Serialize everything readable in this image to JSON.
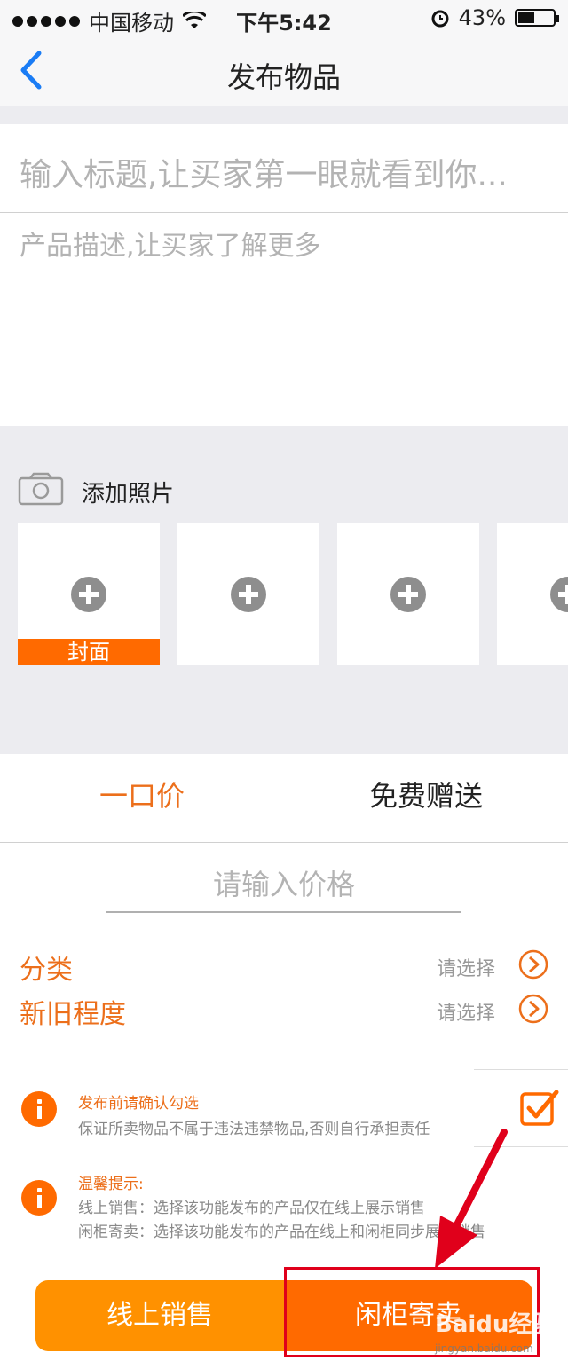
{
  "status_bar": {
    "carrier": "中国移动",
    "time": "下午5:42",
    "battery": "43%",
    "battery_level": 0.43
  },
  "nav": {
    "title": "发布物品"
  },
  "form": {
    "title_placeholder": "输入标题,让买家第一眼就看到你...",
    "description_placeholder": "产品描述,让买家了解更多"
  },
  "photos": {
    "label": "添加照片",
    "cover_label": "封面"
  },
  "price_tabs": [
    {
      "label": "一口价"
    },
    {
      "label": "免费赠送"
    }
  ],
  "price": {
    "placeholder": "请输入价格"
  },
  "options": [
    {
      "label": "分类",
      "value": "请选择"
    },
    {
      "label": "新旧程度",
      "value": "请选择"
    }
  ],
  "confirm": {
    "title": "发布前请确认勾选",
    "text": "保证所卖物品不属于违法违禁物品,否则自行承担责任"
  },
  "tips": {
    "title": "温馨提示:",
    "line1": "线上销售：选择该功能发布的产品仅在线上展示销售",
    "line2": "闲柜寄卖：选择该功能发布的产品在线上和闲柜同步展示销售"
  },
  "buttons": {
    "online": "线上销售",
    "consign": "闲柜寄卖"
  },
  "watermark": {
    "brand": "Baidu经验",
    "url": "jingyan.baidu.com"
  },
  "colors": {
    "accent": "#ec6f1b",
    "orange_button": "#ff9100",
    "deep_orange": "#ff6a00",
    "annotation_red": "#e0001b"
  }
}
